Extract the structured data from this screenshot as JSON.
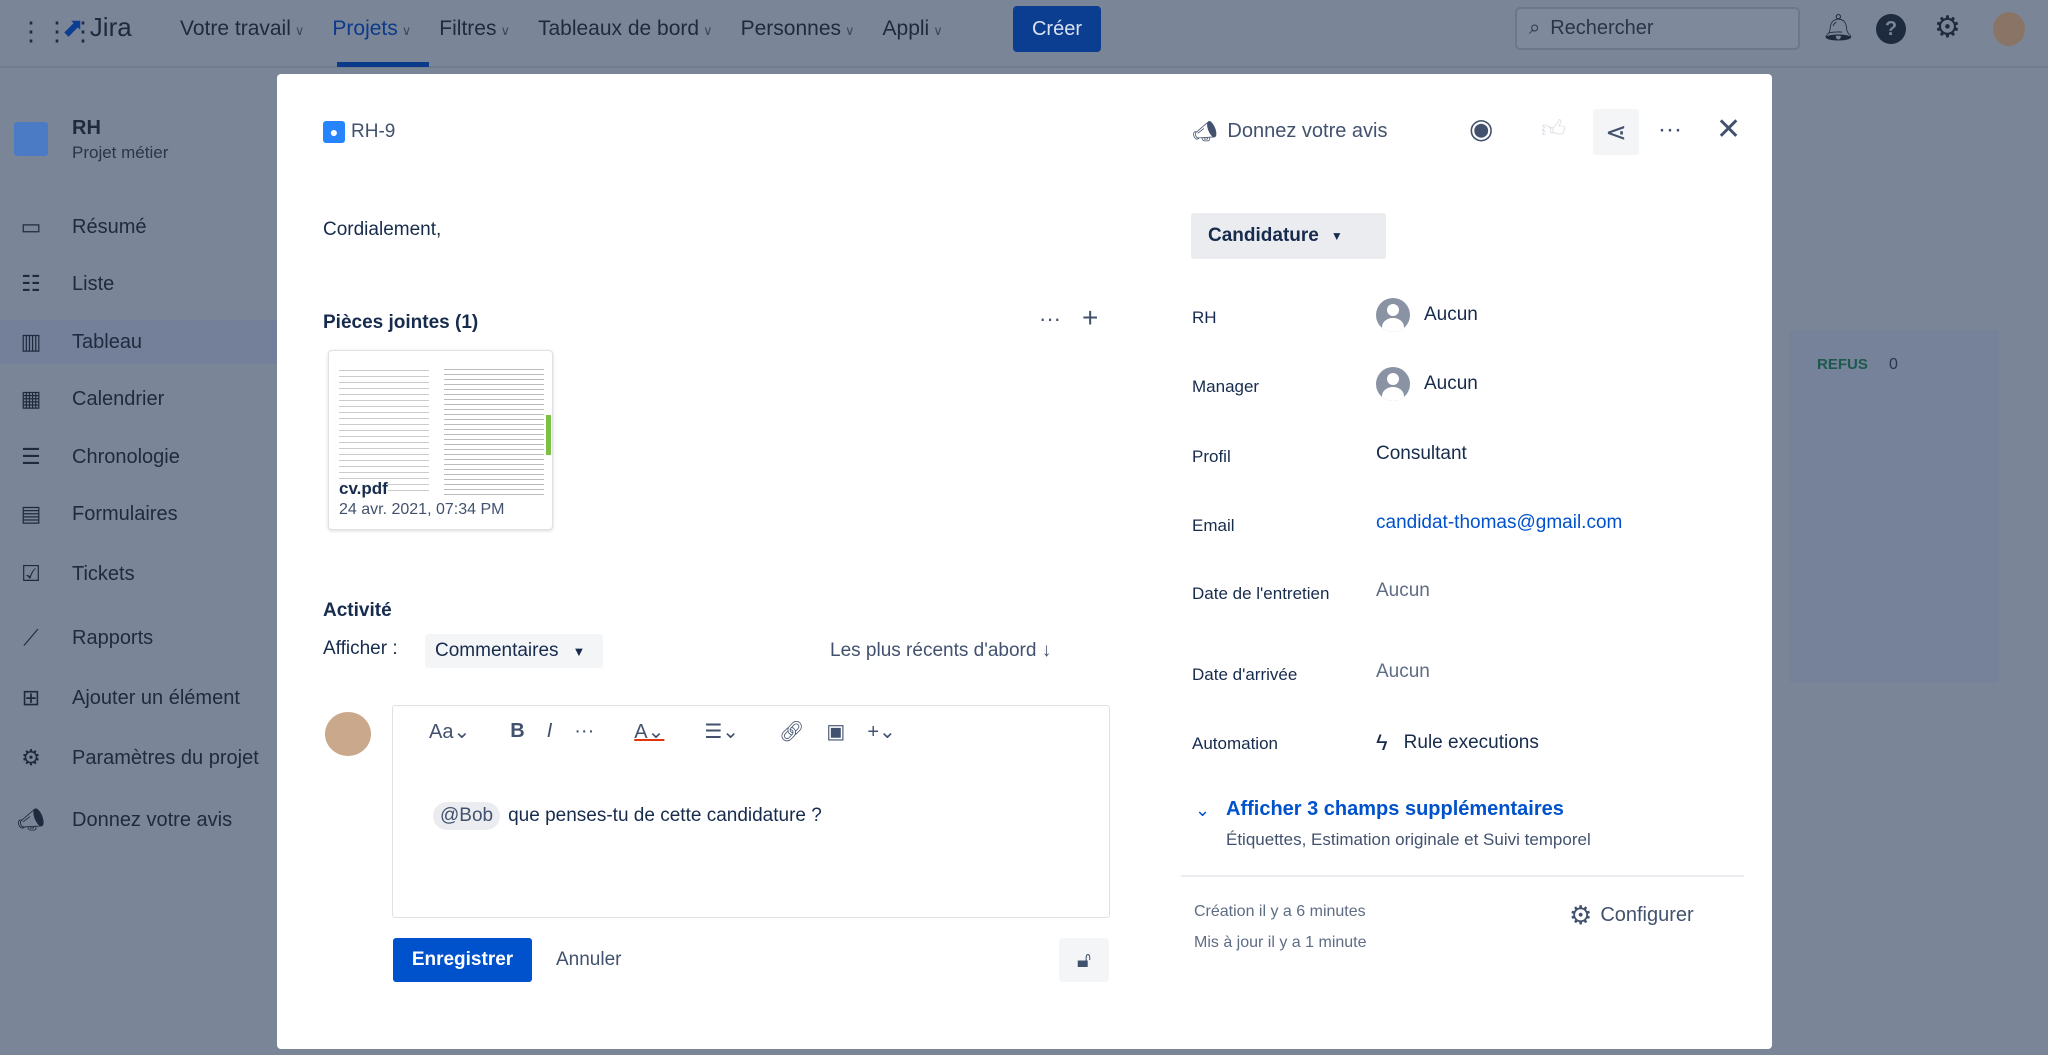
{
  "topbar": {
    "logo": "Jira",
    "nav": [
      {
        "label": "Votre travail"
      },
      {
        "label": "Projets",
        "active": true
      },
      {
        "label": "Filtres"
      },
      {
        "label": "Tableaux de bord"
      },
      {
        "label": "Personnes"
      },
      {
        "label": "Appli"
      }
    ],
    "create": "Créer",
    "search_placeholder": "Rechercher"
  },
  "sidebar": {
    "project_name": "RH",
    "project_type": "Projet métier",
    "items": [
      {
        "label": "Résumé",
        "icon": "summary-icon"
      },
      {
        "label": "Liste",
        "icon": "list-icon"
      },
      {
        "label": "Tableau",
        "icon": "board-icon",
        "active": true
      },
      {
        "label": "Calendrier",
        "icon": "calendar-icon"
      },
      {
        "label": "Chronologie",
        "icon": "timeline-icon"
      },
      {
        "label": "Formulaires",
        "icon": "forms-icon"
      },
      {
        "label": "Tickets",
        "icon": "tickets-icon"
      },
      {
        "label": "Rapports",
        "icon": "reports-icon"
      },
      {
        "label": "Ajouter un élément",
        "icon": "add-item-icon"
      },
      {
        "label": "Paramètres du projet",
        "icon": "gear-icon"
      },
      {
        "label": "Donnez votre avis",
        "icon": "megaphone-icon"
      }
    ]
  },
  "board": {
    "column": "REFUS",
    "count": "0"
  },
  "issue": {
    "key": "RH-9",
    "feedback": "Donnez votre avis",
    "body_text": "Cordialement,",
    "attachments": {
      "title": "Pièces jointes (1)",
      "file": {
        "name": "cv.pdf",
        "date": "24 avr. 2021, 07:34 PM"
      }
    },
    "activity": {
      "title": "Activité",
      "show_label": "Afficher :",
      "filter": "Commentaires",
      "sort": "Les plus récents d'abord ↓"
    },
    "comment": {
      "toolbar": {
        "text_style": "Aa"
      },
      "mention": "@Bob",
      "text": "que penses-tu de cette candidature ?",
      "save": "Enregistrer",
      "cancel": "Annuler"
    },
    "status": "Candidature",
    "fields": [
      {
        "label": "RH",
        "value": "Aucun",
        "avatar": true
      },
      {
        "label": "Manager",
        "value": "Aucun",
        "avatar": true
      },
      {
        "label": "Profil",
        "value": "Consultant"
      },
      {
        "label": "Email",
        "value": "candidat-thomas@gmail.com",
        "link": true
      },
      {
        "label": "Date de l'entretien",
        "value": "Aucun",
        "muted": true
      },
      {
        "label": "Date d'arrivée",
        "value": "Aucun",
        "muted": true
      },
      {
        "label": "Automation",
        "value": "Rule executions"
      }
    ],
    "more_fields": "Afficher 3 champs supplémentaires",
    "more_fields_sub": "Étiquettes, Estimation originale et Suivi temporel",
    "created": "Création il y a 6 minutes",
    "updated": "Mis à jour il y a 1 minute",
    "configure": "Configurer"
  },
  "colors": {
    "primary": "#0052cc",
    "link": "#0052cc",
    "overlay": "#7b8598"
  }
}
